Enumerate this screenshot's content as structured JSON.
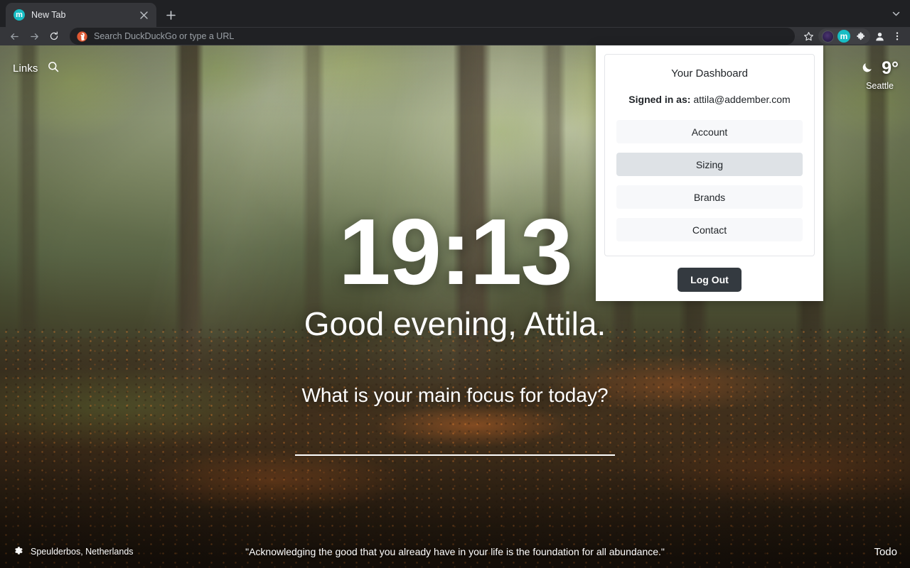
{
  "browser": {
    "tab": {
      "title": "New Tab",
      "favicon_letter": "m",
      "favicon_color": "#18bdc4",
      "close_icon": "close-icon"
    },
    "new_tab_icon": "plus-icon",
    "tab_list_icon": "chevron-down-icon",
    "toolbar": {
      "back_icon": "back-arrow-icon",
      "forward_icon": "forward-arrow-icon",
      "reload_icon": "reload-icon",
      "omnibox_placeholder": "Search DuckDuckGo or type a URL",
      "search_engine_icon": "duckduckgo-icon",
      "bookmark_icon": "star-icon",
      "profile_avatar_icon": "profile-avatar-icon",
      "extension_m_icon": "m-extension-icon",
      "extensions_icon": "puzzle-piece-icon",
      "account_icon": "person-icon",
      "menu_icon": "three-dot-menu-icon"
    }
  },
  "newtab": {
    "links_label": "Links",
    "search_icon": "search-icon",
    "weather": {
      "icon": "crescent-moon-icon",
      "temperature": "9°",
      "city": "Seattle"
    },
    "clock": "19:13",
    "greeting": "Good evening, Attila.",
    "focus_question": "What is your main focus for today?",
    "focus_value": "",
    "focus_placeholder": "",
    "footer": {
      "settings_icon": "gear-icon",
      "location": "Speulderbos, Netherlands",
      "quote": "\"Acknowledging the good that you already have in your life is the foundation for all abundance.\"",
      "todo_label": "Todo"
    }
  },
  "dashboard": {
    "title": "Your Dashboard",
    "signed_in_label": "Signed in as:",
    "email": "attila@addember.com",
    "buttons": [
      {
        "label": "Account",
        "active": false
      },
      {
        "label": "Sizing",
        "active": true
      },
      {
        "label": "Brands",
        "active": false
      },
      {
        "label": "Contact",
        "active": false
      }
    ],
    "logout_label": "Log Out"
  },
  "colors": {
    "accent_teal": "#18bdc4",
    "active_button": "#dee2e6",
    "idle_button": "#f7f8fa",
    "logout_bg": "#343a40",
    "chrome_dark": "#202124"
  }
}
